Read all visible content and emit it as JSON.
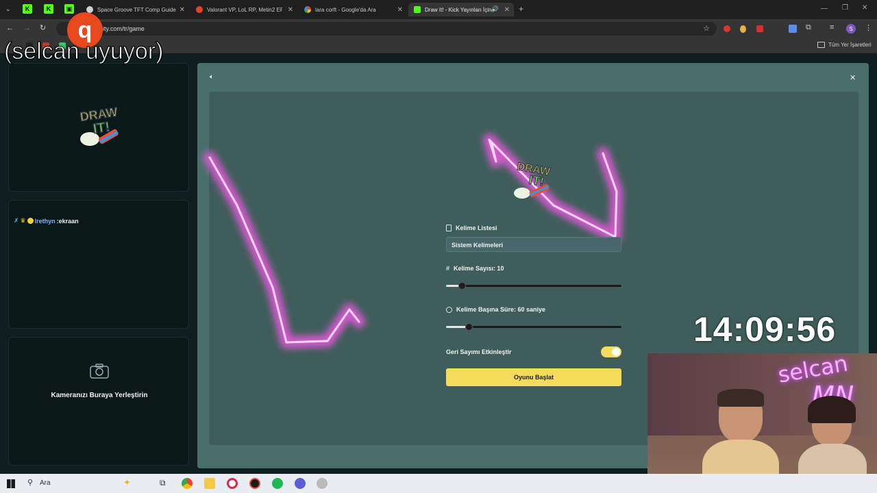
{
  "browser": {
    "tabs": [
      {
        "title": "Space Groove TFT Comp Guide",
        "color": "#f0f0f0"
      },
      {
        "title": "Valorant VP, LoL RP, Metin2 EP",
        "color": "#e0452b"
      },
      {
        "title": "lara corft - Google'da Ara",
        "color": "#ffffff"
      },
      {
        "title": "Draw It! - Kick Yayınları İçin",
        "color": "#53fc18"
      }
    ],
    "url": "ity.com/tr/game",
    "bookmarks_label": "Tüm Yer İşaretleri",
    "profile_initial": "S"
  },
  "overlay": {
    "status_text": "(selcan uyuyor)",
    "badge_icon": "q",
    "clock": "14:09:56"
  },
  "sidebar": {
    "logo_text": "DRAW IT!",
    "chat_user": "lrethyn",
    "chat_message": ":ekraan",
    "camera_placeholder": "Kameranızı Buraya Yerleştirin"
  },
  "modal": {
    "logo_text": "DRAW IT!",
    "word_list_label": "Kelime Listesi",
    "word_list_value": "Sistem Kelimeleri",
    "word_count_label": "Kelime Sayısı: 10",
    "word_count_level": 0.09,
    "time_label": "Kelime Başına Süre: 60 saniye",
    "time_level": 0.13,
    "countdown_label": "Geri Sayımı Etkinleştir",
    "countdown_enabled": true,
    "start_button": "Oyunu Başlat",
    "accent": "#f4db5a"
  },
  "webcam": {
    "neon_text_1": "selcan",
    "neon_text_2": "MN"
  },
  "taskbar": {
    "search_placeholder": "Ara"
  }
}
